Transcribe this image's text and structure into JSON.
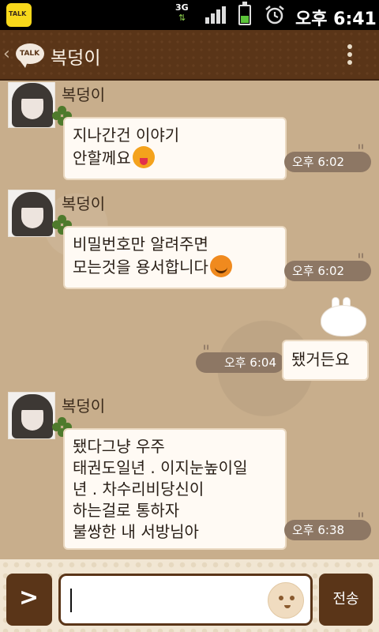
{
  "status_bar": {
    "network": "3G",
    "time": "오후 6:41",
    "app_icon_label": "TALK",
    "icons": [
      "kakaotalk-notification-icon",
      "network-3g-icon",
      "signal-icon",
      "battery-icon",
      "alarm-icon"
    ]
  },
  "header": {
    "title": "복덩이",
    "talk_icon_label": "TALK",
    "icons": [
      "back-icon",
      "talk-bubble-icon",
      "menu-icon"
    ]
  },
  "messages": [
    {
      "side": "left",
      "sender": "복덩이",
      "lines": [
        "지나간건 이야기",
        "안할께요"
      ],
      "emoticon": "tongue-face-emoticon",
      "time": "오후 6:02"
    },
    {
      "side": "left",
      "sender": "복덩이",
      "lines": [
        "비밀번호만 알려주면",
        "모는것을 용서합니다"
      ],
      "emoticon": "devil-face-emoticon",
      "time": "오후 6:02"
    },
    {
      "side": "right",
      "text": "됐거든요",
      "sticker": "bunny-sticker",
      "time": "오후 6:04"
    },
    {
      "side": "left",
      "sender": "복덩이",
      "lines": [
        "됐다그냥 우주",
        "태권도일년 . 이지눈높이일",
        "년 . 차수리비당신이",
        "하는걸로 통하자",
        "불쌍한 내 서방님아"
      ],
      "time": "오후 6:38"
    }
  ],
  "input_bar": {
    "plus_label": ">",
    "message_value": "",
    "send_label": "전송",
    "icons": [
      "emoticon-icon"
    ]
  },
  "colors": {
    "header_brown": "#5a3518",
    "chat_background": "#c8ae8c",
    "bubble_white": "#fffaf4",
    "time_pill": "#8d7764",
    "kakao_yellow": "#f8d81b"
  }
}
